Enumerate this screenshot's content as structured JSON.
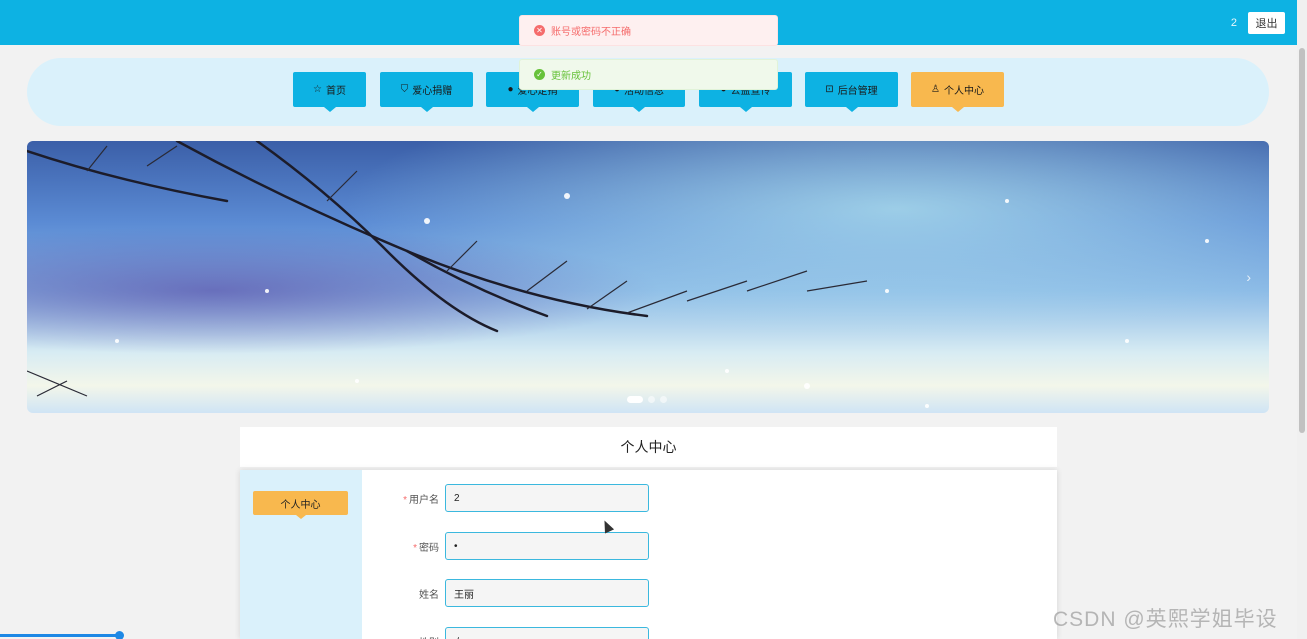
{
  "topbar": {
    "username": "2",
    "logout_label": "退出",
    "background": "#0db2e3"
  },
  "toasts": [
    {
      "type": "error",
      "message": "账号或密码不正确"
    },
    {
      "type": "success",
      "message": "更新成功"
    }
  ],
  "nav": {
    "items": [
      {
        "label": "首页",
        "icon": "star-icon",
        "active": false
      },
      {
        "label": "爱心捐赠",
        "icon": "bag-icon",
        "active": false
      },
      {
        "label": "爱心定捐",
        "icon": "info-icon",
        "active": false
      },
      {
        "label": "活动信息",
        "icon": "info-icon",
        "active": false
      },
      {
        "label": "公益宣传",
        "icon": "info-icon",
        "active": false
      },
      {
        "label": "后台管理",
        "icon": "briefcase-icon",
        "active": false
      },
      {
        "label": "个人中心",
        "icon": "user-icon",
        "active": true
      }
    ],
    "active_color": "#f8b84e"
  },
  "carousel": {
    "slide_count": 3,
    "active_index": 0
  },
  "center": {
    "title": "个人中心",
    "sidebar_item": "个人中心",
    "form": [
      {
        "label": "用户名",
        "required": true,
        "value": "2"
      },
      {
        "label": "密码",
        "required": true,
        "value": "•"
      },
      {
        "label": "姓名",
        "required": false,
        "value": "王丽"
      },
      {
        "label": "性别",
        "required": false,
        "value": "女"
      }
    ]
  },
  "progress": {
    "value": 0.09
  },
  "watermark": "CSDN @英熙学姐毕设"
}
